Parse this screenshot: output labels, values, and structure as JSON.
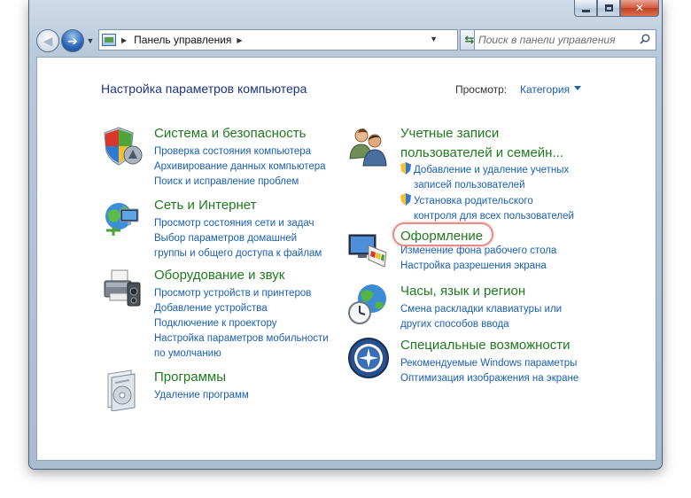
{
  "address": {
    "breadcrumb": "Панель управления"
  },
  "search": {
    "placeholder": "Поиск в панели управления"
  },
  "main": {
    "title": "Настройка параметров компьютера",
    "view_label": "Просмотр:",
    "view_value": "Категория"
  },
  "left": [
    {
      "heading": "Система и безопасность",
      "icon": "shield-icon",
      "links": [
        "Проверка состояния компьютера",
        "Архивирование данных компьютера",
        "Поиск и исправление проблем"
      ]
    },
    {
      "heading": "Сеть и Интернет",
      "icon": "network-globe-icon",
      "links": [
        "Просмотр состояния сети и задач",
        "Выбор параметров домашней",
        "группы и общего доступа к файлам"
      ]
    },
    {
      "heading": "Оборудование и звук",
      "icon": "printer-icon",
      "links": [
        "Просмотр устройств и принтеров",
        "Добавление устройства",
        "Подключение к проектору",
        "Настройка параметров мобильности",
        "по умолчанию"
      ]
    },
    {
      "heading": "Программы",
      "icon": "programs-icon",
      "links": [
        "Удаление программ"
      ]
    }
  ],
  "right": [
    {
      "heading_line1": "Учетные записи",
      "heading_line2": "пользователей и семейн...",
      "icon": "users-icon",
      "links": [
        "Добавление и удаление учетных",
        "записей пользователей",
        "Установка родительского",
        "контроля для всех пользователей"
      ]
    },
    {
      "heading": "Оформление",
      "icon": "appearance-icon",
      "links": [
        "Изменение фона рабочего стола",
        "Настройка разрешения экрана"
      ]
    },
    {
      "heading": "Часы, язык и регион",
      "icon": "clock-globe-icon",
      "links": [
        "Смена раскладки клавиатуры или",
        "других способов ввода"
      ]
    },
    {
      "heading": "Специальные возможности",
      "icon": "accessibility-icon",
      "links": [
        "Рекомендуемые Windows параметры",
        "Оптимизация изображения на экране"
      ]
    }
  ]
}
